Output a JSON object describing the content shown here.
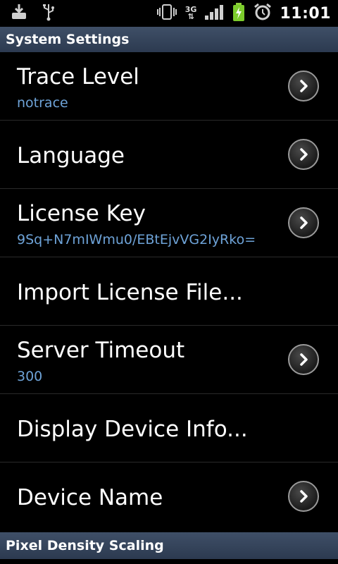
{
  "status_bar": {
    "time": "11:01",
    "network_label": "3G",
    "icons": [
      "download-icon",
      "usb-icon",
      "vibrate-icon",
      "signal-icon",
      "battery-charging-icon",
      "alarm-icon"
    ]
  },
  "headers": {
    "system": "System Settings",
    "pixel": "Pixel Density Scaling"
  },
  "items": [
    {
      "title": "Trace Level",
      "subtitle": "notrace",
      "chevron": true
    },
    {
      "title": "Language",
      "subtitle": "",
      "chevron": true
    },
    {
      "title": "License Key",
      "subtitle": "9Sq+N7mIWmu0/EBtEjvVG2IyRko=",
      "chevron": true
    },
    {
      "title": "Import License File...",
      "subtitle": "",
      "chevron": false
    },
    {
      "title": "Server Timeout",
      "subtitle": "300",
      "chevron": true
    },
    {
      "title": "Display Device Info...",
      "subtitle": "",
      "chevron": false
    },
    {
      "title": "Device Name",
      "subtitle": "",
      "chevron": true
    }
  ],
  "colors": {
    "header_bg": "#34445c",
    "subtitle": "#6ea3d8"
  }
}
